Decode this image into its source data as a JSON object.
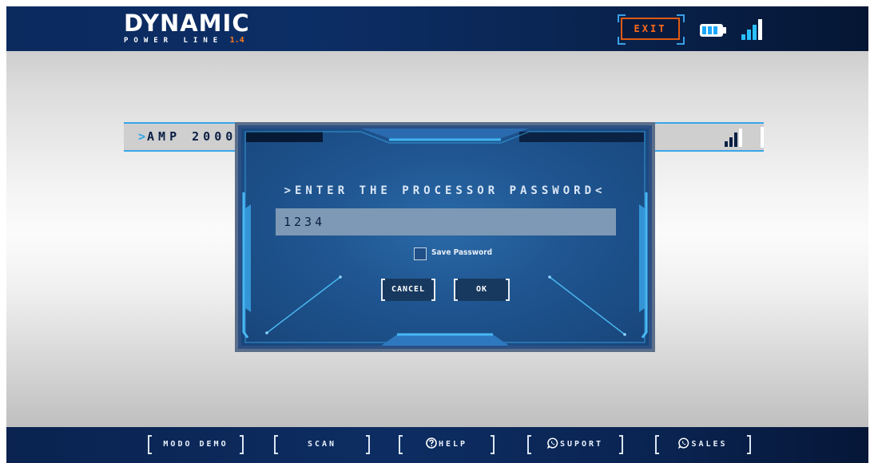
{
  "app": {
    "logo_main": "DYNAMIC",
    "logo_sub": "POWER LINE",
    "logo_version": "1.4"
  },
  "header": {
    "exit_label": "EXIT",
    "battery_icon": "battery-icon",
    "signal_icon": "signal-bars-icon"
  },
  "device": {
    "name_prefix": ">",
    "name": "AMP 2000",
    "signal_icon": "signal-bars-icon"
  },
  "dialog": {
    "title": ">ENTER THE PROCESSOR PASSWORD<",
    "password_value": "1234",
    "save_password_label": "Save Password",
    "save_password_checked": false,
    "cancel_label": "CANCEL",
    "ok_label": "OK"
  },
  "footer": {
    "buttons": [
      {
        "label": "MODO DEMO",
        "icon": ""
      },
      {
        "label": "SCAN",
        "icon": ""
      },
      {
        "label": "HELP",
        "icon": "help-circle-icon"
      },
      {
        "label": "SUPORT",
        "icon": "whatsapp-icon"
      },
      {
        "label": "SALES",
        "icon": "whatsapp-icon"
      }
    ]
  },
  "colors": {
    "header_bg": "#0b2a5e",
    "accent_blue": "#38a6e8",
    "exit_orange": "#e05a12",
    "dialog_bg": "#1f5590",
    "input_bg": "#7e99b5",
    "battery_fill": "#29c0ff"
  }
}
